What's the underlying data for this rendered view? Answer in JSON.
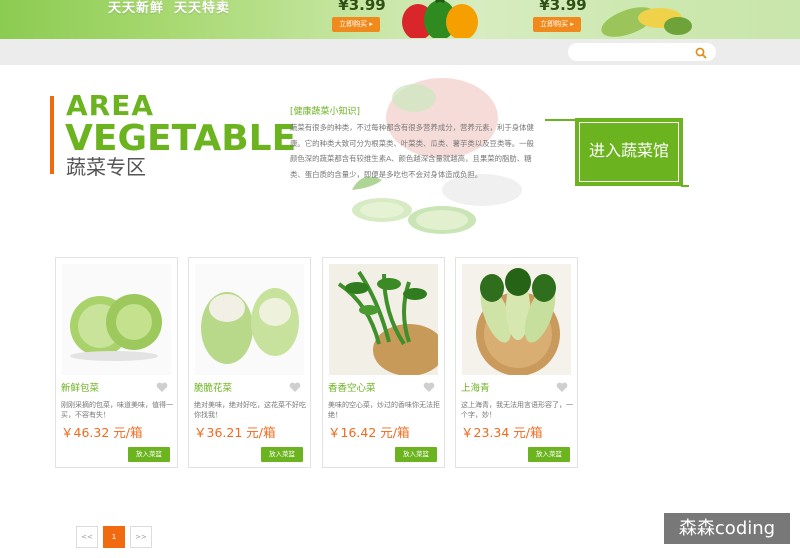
{
  "banner": {
    "slogan1": "天天新鲜",
    "slogan2": "天天特卖",
    "promos": [
      {
        "price": "¥3.99",
        "button": "立即购买 ▸"
      },
      {
        "price": "¥3.99",
        "button": "立即购买 ▸"
      }
    ]
  },
  "search": {
    "placeholder": "",
    "value": ""
  },
  "area": {
    "title_en_1": "AREA",
    "title_en_2": "VEGETABLE",
    "title_cn": "蔬菜专区",
    "tips_title": "[健康蔬菜小知识]",
    "tips_text": "蔬菜有很多的种类，不过每种都含有很多营养成分，营养元素，利于身体健康。它的种类大致可分为根菜类、叶菜类、瓜类、薯芋类以及豆类等。一般颜色深的蔬菜都含有较维生素A、颜色越深含量就越高，且果菜的脂肪、糖类、蛋白质的含量少，即便是多吃也不会对身体造成负担。",
    "enter_label": "进入蔬菜馆"
  },
  "products": [
    {
      "name": "新鲜包菜",
      "desc": "刚刚采摘的包菜，味道美味，值得一买，不容有失！",
      "price": "￥46.32 元/箱",
      "button": "放入菜篮"
    },
    {
      "name": "脆脆花菜",
      "desc": "绝对美味，绝对好吃，这花菜不好吃你找我！",
      "price": "￥36.21 元/箱",
      "button": "放入菜篮"
    },
    {
      "name": "香香空心菜",
      "desc": "美味的空心菜，炒过的香味你无法拒绝！",
      "price": "￥16.42 元/箱",
      "button": "放入菜篮"
    },
    {
      "name": "上海青",
      "desc": "这上海青，我无法用言语形容了，一个字，妙！",
      "price": "￥23.34 元/箱",
      "button": "放入菜篮"
    }
  ],
  "pagination": {
    "prev": "<<",
    "current": "1",
    "next": ">>"
  },
  "watermark": "森森coding",
  "colors": {
    "accent_green": "#6cb320",
    "accent_orange": "#f06a10",
    "price_orange": "#ef6a1d"
  }
}
